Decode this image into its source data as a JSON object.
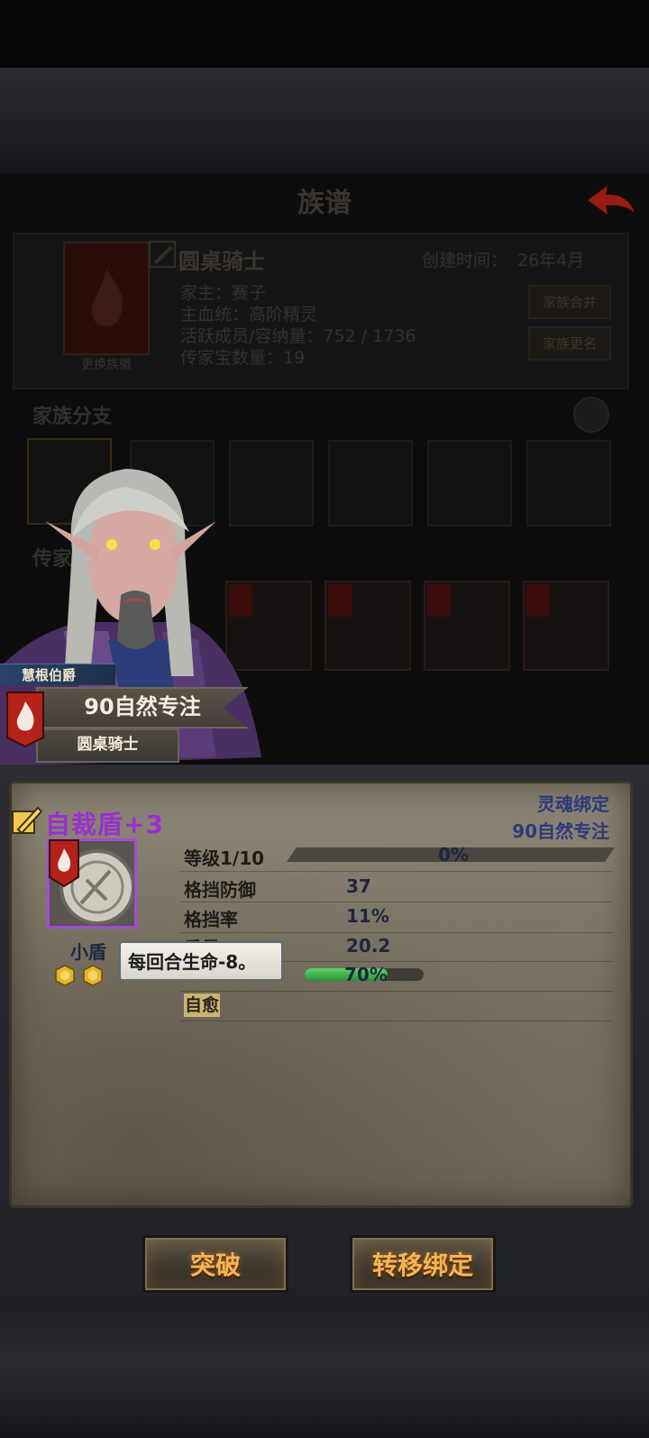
{
  "background_screen": {
    "title": "族谱",
    "guild_name": "圆桌骑士",
    "change_emblem": "更换族徽",
    "founded_label": "创建时间：",
    "founded_value": "26年4月",
    "leader": "家主：赛子",
    "main_race": "主血统：高阶精灵",
    "active_members": "活跃成员/容纳量：752 / 1736",
    "heirloom_count": "传家宝数量：19",
    "merge_button": "家族合并",
    "rename_button": "家族更名",
    "branch_section": "家族分支",
    "heirloom_section": "传家宝"
  },
  "character": {
    "name": "慧根伯爵",
    "title": "90自然专注",
    "guild": "圆桌骑士"
  },
  "item": {
    "name": "自裁盾+3",
    "type": "小盾",
    "binding": "灵魂绑定",
    "binding_focus": "90自然专注",
    "level_label": "等级1/10",
    "level_progress": 0,
    "level_percent": "0%",
    "stats": [
      {
        "label": "格挡防御",
        "value": "37"
      },
      {
        "label": "格挡率",
        "value": "11%"
      },
      {
        "label": "重量",
        "value": "20.2"
      }
    ],
    "trigger_chance": 0.7,
    "trigger_percent": "70%",
    "skill_tag": "自愈",
    "tooltip": "每回合生命-8。",
    "gem_slots": 2
  },
  "buttons": {
    "breakthrough": "突破",
    "transfer_binding": "转移绑定"
  },
  "colors": {
    "item_purple": "#9a2fd0",
    "text_blue": "#1d2740",
    "button_orange": "#f6b455",
    "emblem_red": "#b3221c"
  }
}
